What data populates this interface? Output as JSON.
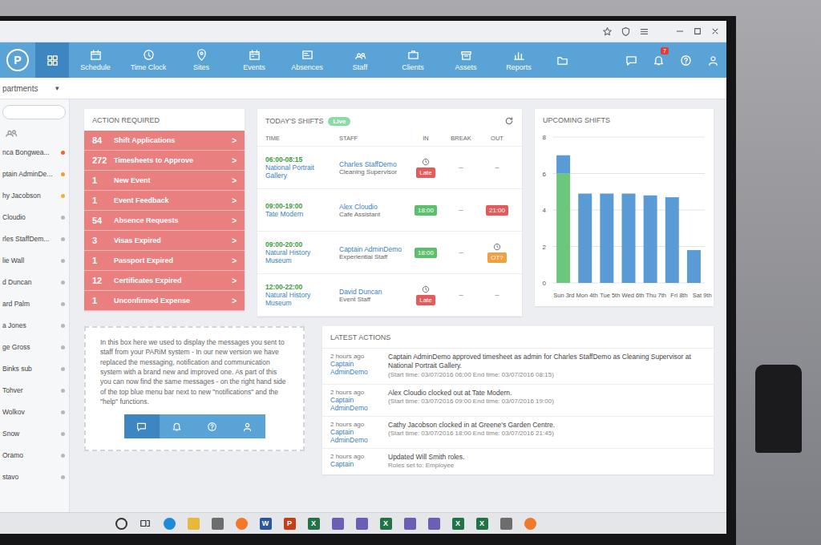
{
  "app": {
    "logo": "P"
  },
  "nav": {
    "home_selected": true,
    "items": [
      {
        "label": "Schedule",
        "selected": false
      },
      {
        "label": "Time Clock",
        "selected": false
      },
      {
        "label": "Sites",
        "selected": false
      },
      {
        "label": "Events",
        "selected": false
      },
      {
        "label": "Absences",
        "selected": false
      },
      {
        "label": "Staff",
        "selected": false
      },
      {
        "label": "Clients",
        "selected": false
      },
      {
        "label": "Assets",
        "selected": false
      },
      {
        "label": "Reports",
        "selected": false
      }
    ],
    "badge": "7"
  },
  "departments": {
    "label": "partments",
    "caret": "▾"
  },
  "sidebar": {
    "staff": [
      {
        "name": "nca Bongwea...",
        "color": "#e8663c"
      },
      {
        "name": "ptain AdminDe...",
        "color": "#f0a030"
      },
      {
        "name": "hy Jacobson",
        "color": "#f0b437"
      },
      {
        "name": "Cloudio",
        "color": "#b8b8b8"
      },
      {
        "name": "rles StaffDem...",
        "color": "#b8b8b8"
      },
      {
        "name": "lie Wall",
        "color": "#b8b8b8"
      },
      {
        "name": "d Duncan",
        "color": "#b8b8b8"
      },
      {
        "name": "ard Palm",
        "color": "#b8b8b8"
      },
      {
        "name": "a Jones",
        "color": "#b8b8b8"
      },
      {
        "name": "ge Gross",
        "color": "#b8b8b8"
      },
      {
        "name": "Binks sub",
        "color": "#b8b8b8"
      },
      {
        "name": "Tohver",
        "color": "#b8b8b8"
      },
      {
        "name": "Wolkov",
        "color": "#b8b8b8"
      },
      {
        "name": "Snow",
        "color": "#b8b8b8"
      },
      {
        "name": "Oramo",
        "color": "#b8b8b8"
      },
      {
        "name": "stavo",
        "color": "#b8b8b8"
      }
    ]
  },
  "action_required": {
    "title": "ACTION REQUIRED",
    "arrow": ">",
    "items": [
      {
        "count": "84",
        "label": "Shift Applications"
      },
      {
        "count": "272",
        "label": "Timesheets to Approve"
      },
      {
        "count": "1",
        "label": "New Event"
      },
      {
        "count": "1",
        "label": "Event Feedback"
      },
      {
        "count": "54",
        "label": "Absence Requests"
      },
      {
        "count": "3",
        "label": "Visas Expired"
      },
      {
        "count": "1",
        "label": "Passport Expired"
      },
      {
        "count": "12",
        "label": "Certificates Expired"
      },
      {
        "count": "1",
        "label": "Unconfirmed Expense"
      }
    ]
  },
  "todays_shifts": {
    "title": "TODAY'S SHIFTS",
    "badge": "Live",
    "columns": [
      "TIME",
      "STAFF",
      "IN",
      "BREAK",
      "OUT"
    ],
    "rows": [
      {
        "time": "06:00-08:15",
        "site": "National Portrait Gallery",
        "staff": "Charles StaffDemo",
        "role": "Cleaning Supervisor",
        "in": {
          "kind": "pill",
          "text": "Late",
          "color": "#e35b5b",
          "clock": true
        },
        "break": "–",
        "out": {
          "kind": "plain",
          "text": "–",
          "color": "#888888",
          "clock": false
        }
      },
      {
        "time": "09:00-19:00",
        "site": "Tate Modern",
        "staff": "Alex Cloudio",
        "role": "Cafe Assistant",
        "in": {
          "kind": "pill",
          "text": "18:00",
          "color": "#5cbf6c",
          "clock": false
        },
        "break": "–",
        "out": {
          "kind": "pill",
          "text": "21:00",
          "color": "#e35b5b",
          "clock": false
        }
      },
      {
        "time": "09:00-20:00",
        "site": "Natural History Museum",
        "staff": "Captain AdminDemo",
        "role": "Experiential Staff",
        "in": {
          "kind": "pill",
          "text": "18:00",
          "color": "#5cbf6c",
          "clock": false
        },
        "break": "–",
        "out": {
          "kind": "pill",
          "text": "OT?",
          "color": "#f0a040",
          "clock": true
        }
      },
      {
        "time": "12:00-22:00",
        "site": "Natural History Museum",
        "staff": "David Duncan",
        "role": "Event Staff",
        "in": {
          "kind": "pill",
          "text": "Late",
          "color": "#e35b5b",
          "clock": true
        },
        "break": "–",
        "out": {
          "kind": "plain",
          "text": "–",
          "color": "#888888",
          "clock": false
        }
      }
    ]
  },
  "upcoming_shifts": {
    "title": "UPCOMING SHIFTS",
    "y_ticks": [
      "8",
      "6",
      "4",
      "2",
      "0"
    ],
    "days": [
      "Sun 3rd",
      "Mon 4th",
      "Tue 5th",
      "Wed 6th",
      "Thu 7th",
      "Fri 8th",
      "Sat 9th"
    ],
    "series": [
      {
        "color": "#6cc77c",
        "values": [
          6,
          0,
          0,
          0,
          0,
          0,
          0
        ]
      },
      {
        "color": "#5b9bd5",
        "values": [
          1,
          4.9,
          4.9,
          4.9,
          4.8,
          4.7,
          1.8
        ]
      }
    ]
  },
  "messages_box": {
    "text": "In this box here we used to display the messages you sent to staff from your PARiM system - In our new version we have replaced the messaging, notification and communication system with a brand new and improved one. As part of this you can now find the same messages - on the right hand side of the top blue menu bar next to new \"notifications\" and the \"help\" functions.",
    "buttons": [
      {
        "selected": true
      },
      {
        "selected": false
      },
      {
        "selected": false
      },
      {
        "selected": false
      }
    ]
  },
  "latest_actions": {
    "title": "LATEST ACTIONS",
    "rows": [
      {
        "when": "2 hours ago",
        "who": "Captain AdminDemo",
        "text": "Captain AdminDemo approved timesheet as admin for Charles StaffDemo as Cleaning Supervisor at National Portrait Gallery.",
        "detail": "(Start time: 03/07/2016 06:00 End time: 03/07/2016 08:15)"
      },
      {
        "when": "2 hours ago",
        "who": "Captain AdminDemo",
        "text": "Alex Cloudio clocked out at Tate Modern.",
        "detail": "(Start time: 03/07/2016 09:00 End time: 03/07/2016 19:00)"
      },
      {
        "when": "2 hours ago",
        "who": "Captain AdminDemo",
        "text": "Cathy Jacobson clocked in at Greene's Garden Centre.",
        "detail": "(Start time: 03/07/2016 18:00 End time: 03/07/2016 21:45)"
      },
      {
        "when": "2 hours ago",
        "who": "Captain",
        "text": "Updated Will Smith roles.",
        "detail": "Roles set to: Employee"
      }
    ]
  },
  "taskbar": {
    "items": [
      {
        "kind": "ring",
        "glyph": "",
        "color": "#333333"
      },
      {
        "kind": "taskview",
        "glyph": "",
        "color": "#333333"
      },
      {
        "kind": "round",
        "glyph": "",
        "color": "#1f8ad6"
      },
      {
        "kind": "tile",
        "glyph": "",
        "color": "#e8b83a"
      },
      {
        "kind": "tile",
        "glyph": "",
        "color": "#6d6d6d"
      },
      {
        "kind": "round",
        "glyph": "",
        "color": "#f07a2a"
      },
      {
        "kind": "tile",
        "glyph": "W",
        "color": "#2b579a"
      },
      {
        "kind": "tile",
        "glyph": "P",
        "color": "#c43e1c"
      },
      {
        "kind": "tile",
        "glyph": "X",
        "color": "#217346"
      },
      {
        "kind": "tile",
        "glyph": "",
        "color": "#6b5fb5"
      },
      {
        "kind": "tile",
        "glyph": "",
        "color": "#6b5fb5"
      },
      {
        "kind": "tile",
        "glyph": "X",
        "color": "#217346"
      },
      {
        "kind": "tile",
        "glyph": "",
        "color": "#6b5fb5"
      },
      {
        "kind": "tile",
        "glyph": "",
        "color": "#6b5fb5"
      },
      {
        "kind": "tile",
        "glyph": "X",
        "color": "#217346"
      },
      {
        "kind": "tile",
        "glyph": "X",
        "color": "#217346"
      },
      {
        "kind": "tile",
        "glyph": "",
        "color": "#6d6d6d"
      },
      {
        "kind": "round",
        "glyph": "",
        "color": "#f07a2a"
      }
    ]
  }
}
